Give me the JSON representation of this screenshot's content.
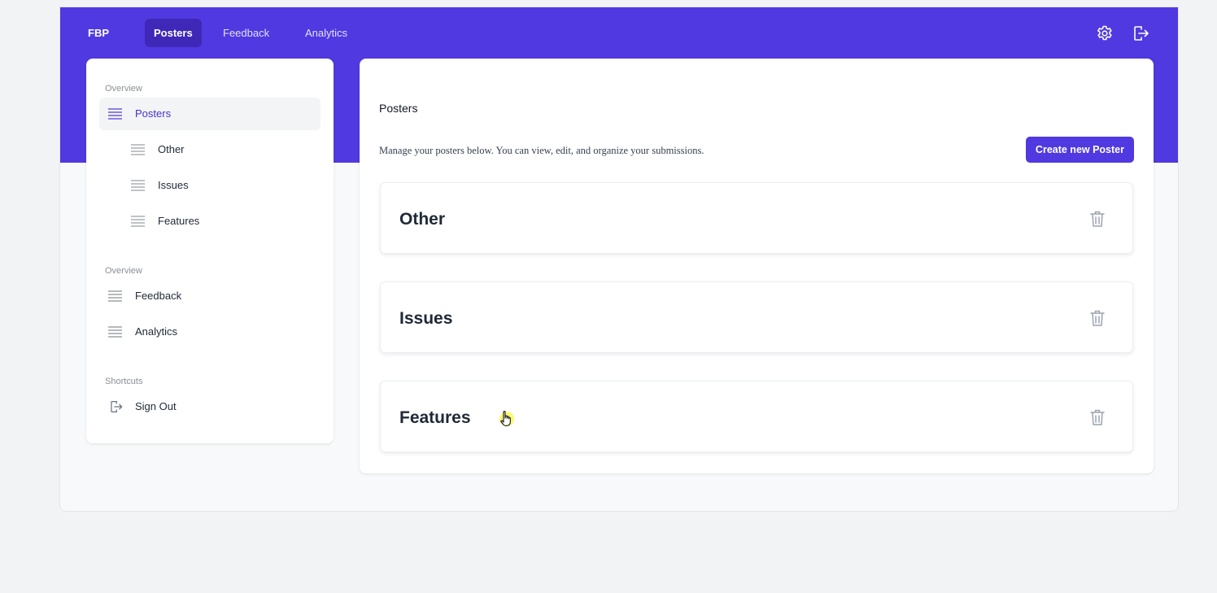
{
  "nav": {
    "brand": "FBP",
    "tabs": [
      {
        "label": "Posters",
        "active": true
      },
      {
        "label": "Feedback",
        "active": false
      },
      {
        "label": "Analytics",
        "active": false
      }
    ],
    "icons": [
      "settings-icon",
      "logout-icon"
    ]
  },
  "sidebar": {
    "sections": [
      {
        "label": "Overview"
      },
      {
        "label": "Overview"
      },
      {
        "label": "Shortcuts"
      }
    ],
    "items": [
      {
        "label": "Posters",
        "icon": "list-icon",
        "active": true
      },
      {
        "label": "Other",
        "icon": "list-icon"
      },
      {
        "label": "Issues",
        "icon": "list-icon"
      },
      {
        "label": "Features",
        "icon": "list-icon"
      },
      {
        "label": "Feedback",
        "icon": "list-icon"
      },
      {
        "label": "Analytics",
        "icon": "list-icon"
      },
      {
        "label": "Sign Out",
        "icon": "logout-icon"
      }
    ]
  },
  "main": {
    "title": "Posters",
    "description": "Manage your posters below. You can view, edit, and organize your submissions.",
    "create_label": "Create new Poster",
    "posters": [
      {
        "title": "Other"
      },
      {
        "title": "Issues"
      },
      {
        "title": "Features"
      }
    ]
  },
  "colors": {
    "accent": "#5039e0",
    "accent_dark": "#3f28b8",
    "background": "#f2f3f5"
  }
}
